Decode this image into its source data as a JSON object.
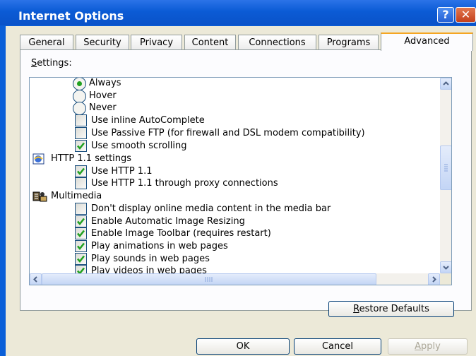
{
  "window": {
    "title": "Internet Options",
    "help_glyph": "?",
    "close_glyph": "✕"
  },
  "tabs": [
    {
      "label": "General"
    },
    {
      "label": "Security"
    },
    {
      "label": "Privacy"
    },
    {
      "label": "Content"
    },
    {
      "label": "Connections"
    },
    {
      "label": "Programs"
    },
    {
      "label": "Advanced",
      "selected": true
    }
  ],
  "settings": {
    "label_prefix": "",
    "label_underlined": "S",
    "label_rest": "ettings:",
    "items": [
      {
        "kind": "radio",
        "label": "Always",
        "checked": true
      },
      {
        "kind": "radio",
        "label": "Hover",
        "checked": false
      },
      {
        "kind": "radio",
        "label": "Never",
        "checked": false
      },
      {
        "kind": "checkbox",
        "label": "Use inline AutoComplete",
        "checked": false
      },
      {
        "kind": "checkbox",
        "label": "Use Passive FTP (for firewall and DSL modem compatibility)",
        "checked": false
      },
      {
        "kind": "checkbox",
        "label": "Use smooth scrolling",
        "checked": true
      },
      {
        "kind": "group",
        "label": "HTTP 1.1 settings",
        "icon": "ie-globe-icon"
      },
      {
        "kind": "checkbox",
        "label": "Use HTTP 1.1",
        "checked": true
      },
      {
        "kind": "checkbox",
        "label": "Use HTTP 1.1 through proxy connections",
        "checked": false
      },
      {
        "kind": "group",
        "label": "Multimedia",
        "icon": "multimedia-icon"
      },
      {
        "kind": "checkbox",
        "label": "Don't display online media content in the media bar",
        "checked": false
      },
      {
        "kind": "checkbox",
        "label": "Enable Automatic Image Resizing",
        "checked": true
      },
      {
        "kind": "checkbox",
        "label": "Enable Image Toolbar (requires restart)",
        "checked": true
      },
      {
        "kind": "checkbox",
        "label": "Play animations in web pages",
        "checked": true
      },
      {
        "kind": "checkbox",
        "label": "Play sounds in web pages",
        "checked": true
      },
      {
        "kind": "checkbox",
        "label": "Play videos in web pages",
        "checked": true
      }
    ]
  },
  "restore_button": {
    "underlined": "R",
    "rest": "estore Defaults"
  },
  "buttons": {
    "ok": "OK",
    "cancel": "Cancel",
    "apply_underlined": "A",
    "apply_rest": "pply"
  },
  "colors": {
    "title_bar": "#0b5bd5",
    "face": "#ece9d8",
    "check": "#21a121",
    "selected_tab_accent": "#f5a623"
  }
}
